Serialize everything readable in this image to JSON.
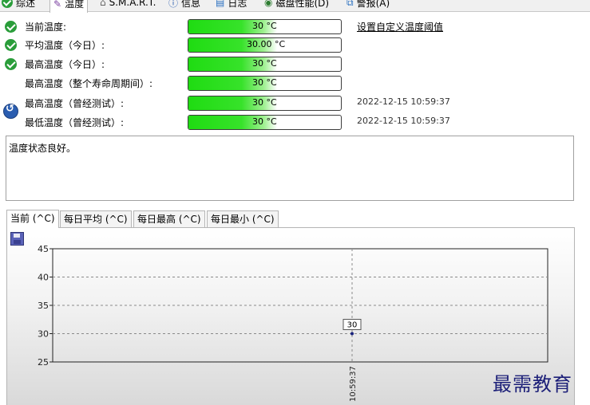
{
  "top_tabs": [
    {
      "label": "综述"
    },
    {
      "label": "温度"
    },
    {
      "label": "S.M.A.R.T."
    },
    {
      "label": "信息"
    },
    {
      "label": "日志"
    },
    {
      "label": "磁盘性能(D)"
    },
    {
      "label": "警报(A)"
    }
  ],
  "rows": [
    {
      "label": "当前温度:",
      "value": "30 °C",
      "fill": 0.58,
      "date": "",
      "ok": true
    },
    {
      "label": "平均温度（今日）:",
      "value": "30.00 °C",
      "fill": 0.58,
      "date": "",
      "ok": true
    },
    {
      "label": "最高温度（今日）:",
      "value": "30 °C",
      "fill": 0.58,
      "date": "",
      "ok": true
    },
    {
      "label": "最高温度（整个寿命周期间）:",
      "value": "30 °C",
      "fill": 0.58,
      "date": "",
      "ok": false
    },
    {
      "label": "最高温度（曾经测试）:",
      "value": "30 °C",
      "fill": 0.58,
      "date": "2022-12-15 10:59:37",
      "ok": false
    },
    {
      "label": "最低温度（曾经测试）:",
      "value": "30 °C",
      "fill": 0.58,
      "date": "2022-12-15 10:59:37",
      "ok": false
    }
  ],
  "threshold_link": "设置自定义温度阈值",
  "status_text": "温度状态良好。",
  "chart_tabs": [
    {
      "label": "当前 (^C)"
    },
    {
      "label": "每日平均 (^C)"
    },
    {
      "label": "每日最高 (^C)"
    },
    {
      "label": "每日最小 (^C)"
    }
  ],
  "watermark": "最需教育",
  "chart_data": {
    "type": "line",
    "x": [
      "10:59:37"
    ],
    "series": [
      {
        "values": [
          30
        ]
      }
    ],
    "data_labels": [
      "30"
    ],
    "ylim": [
      25,
      45
    ],
    "yticks": [
      "25",
      "30",
      "35",
      "40",
      "45"
    ],
    "grid": true
  }
}
